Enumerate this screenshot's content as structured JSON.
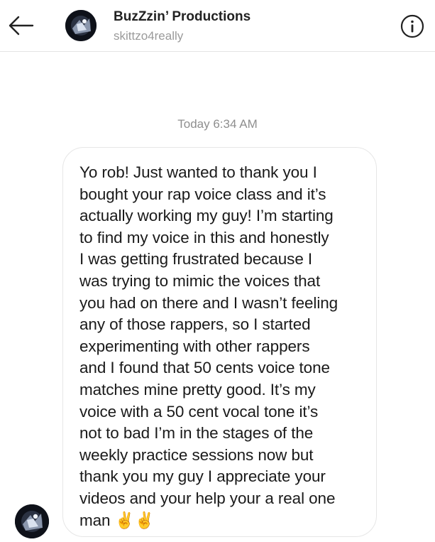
{
  "header": {
    "title": "BuzZzin’ Productions",
    "username": "skittzo4really",
    "back_icon": "arrow-left-icon",
    "info_icon": "info-icon"
  },
  "conversation": {
    "timestamp": "Today 6:34 AM",
    "messages": [
      {
        "sender": "other",
        "text": "Yo rob! Just wanted to thank you I\nbought your rap voice class and it’s\nactually working my guy! I’m starting\nto find my voice in this and honestly\nI was getting frustrated because I\nwas trying to mimic the voices that\nyou had on there and I wasn’t feeling\nany of those rappers, so I started\nexperimenting with other rappers\nand I found that 50 cents voice tone\nmatches mine pretty good. It’s my\nvoice with a 50 cent vocal tone it’s\nnot to bad I’m in the stages of the\nweekly practice sessions now but\nthank you my guy I appreciate your\nvideos and your help your a real one\nman ✌️✌️"
      }
    ]
  },
  "colors": {
    "subtle_text": "#8e8e8e",
    "border": "#e6e6e6",
    "avatar_bg": "#10131c"
  }
}
